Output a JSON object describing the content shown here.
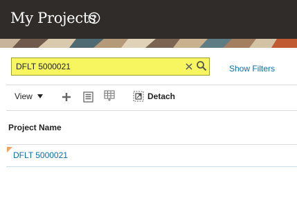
{
  "header": {
    "title": "My Projects",
    "help_icon": "help-circle-icon"
  },
  "search": {
    "value": "DFLT 5000021",
    "clear_icon": "clear-x-icon",
    "search_icon": "magnifier-icon"
  },
  "filters": {
    "show_filters_label": "Show Filters"
  },
  "toolbar": {
    "view_label": "View",
    "add_icon": "plus-icon",
    "edit_icon": "edit-list-icon",
    "freeze_icon": "freeze-columns-icon",
    "detach_label": "Detach",
    "detach_icon": "detach-icon"
  },
  "table": {
    "columns": [
      "Project Name"
    ],
    "rows": [
      {
        "project_name": "DFLT 5000021"
      }
    ]
  },
  "colors": {
    "header_bg": "#2f2c29",
    "search_highlight": "#f7f660",
    "link": "#0b6ea8",
    "row_marker": "#f5a25d"
  }
}
